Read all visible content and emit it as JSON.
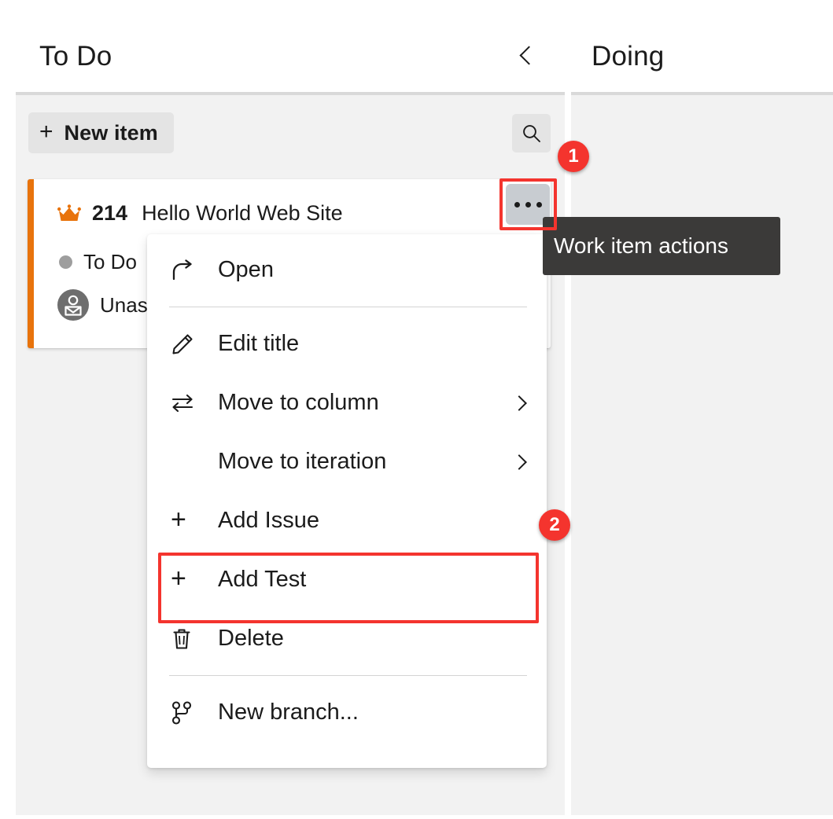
{
  "board": {
    "columns": [
      {
        "title": "To Do"
      },
      {
        "title": "Doing"
      }
    ],
    "collapse_icon": "chevron-left-icon"
  },
  "toolbar": {
    "new_item_label": "New item",
    "new_item_icon": "plus-icon",
    "search_icon": "search-icon"
  },
  "card": {
    "type_icon": "crown-icon",
    "accent_color": "#e8730c",
    "id": "214",
    "title": "Hello World Web Site",
    "state": "To Do",
    "state_dot_color": "#9e9e9e",
    "assignee": "Unassigned",
    "assignee_icon": "person-avatar-icon",
    "actions_icon": "ellipsis-icon"
  },
  "tooltip": {
    "text": "Work item actions",
    "background": "#3b3a39"
  },
  "badges": [
    {
      "label": "1",
      "color": "#f4342e"
    },
    {
      "label": "2",
      "color": "#f4342e"
    }
  ],
  "context_menu": {
    "items": [
      {
        "label": "Open",
        "icon": "open-external-icon",
        "submenu": false
      },
      {
        "label": "Edit title",
        "icon": "pencil-icon",
        "submenu": false
      },
      {
        "label": "Move to column",
        "icon": "swap-arrows-icon",
        "submenu": true
      },
      {
        "label": "Move to iteration",
        "icon": "none",
        "submenu": true
      },
      {
        "label": "Add Issue",
        "icon": "plus-icon",
        "submenu": false
      },
      {
        "label": "Add Test",
        "icon": "plus-icon",
        "submenu": false
      },
      {
        "label": "Delete",
        "icon": "trash-icon",
        "submenu": false
      },
      {
        "label": "New branch...",
        "icon": "branch-icon",
        "submenu": false
      }
    ]
  },
  "highlights": {
    "actions_button_color": "#f4342e",
    "add_test_color": "#f4342e"
  }
}
